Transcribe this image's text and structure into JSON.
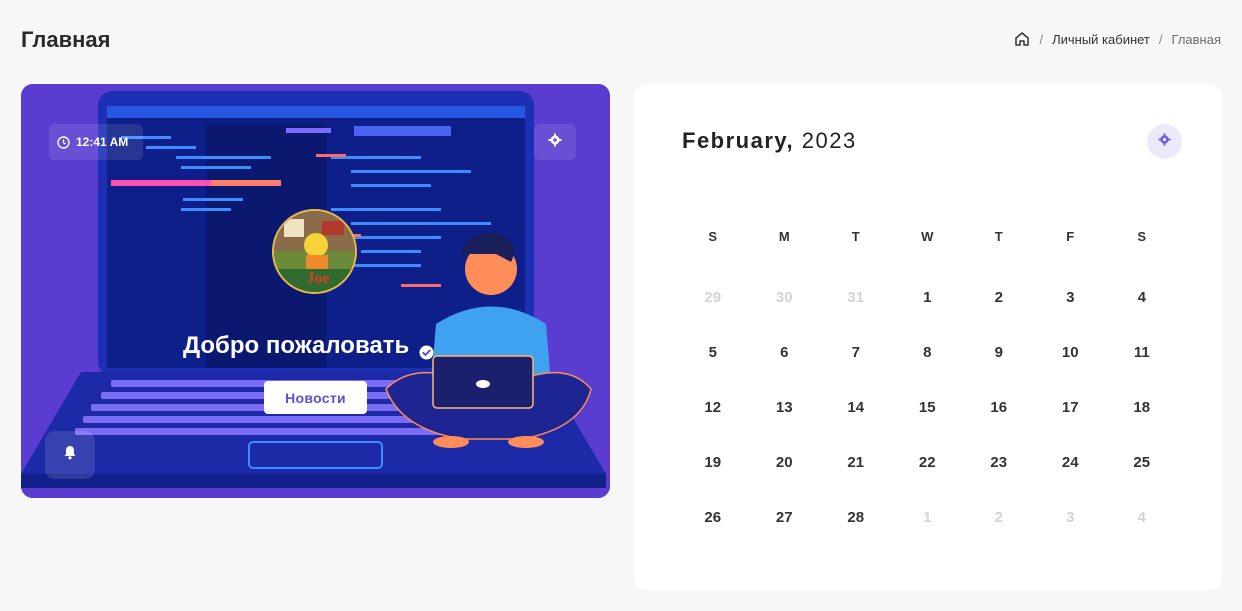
{
  "header": {
    "title": "Главная",
    "breadcrumb": [
      "Личный кабинет",
      "Главная"
    ]
  },
  "hero": {
    "time": "12:41 AM",
    "welcome": "Добро пожаловать",
    "news_button": "Новости",
    "bg_color": "#5b3fd0"
  },
  "calendar": {
    "month": "February,",
    "year": "2023",
    "weekdays": [
      "S",
      "M",
      "T",
      "W",
      "T",
      "F",
      "S"
    ],
    "days": [
      {
        "d": "29",
        "muted": true
      },
      {
        "d": "30",
        "muted": true
      },
      {
        "d": "31",
        "muted": true
      },
      {
        "d": "1"
      },
      {
        "d": "2"
      },
      {
        "d": "3"
      },
      {
        "d": "4"
      },
      {
        "d": "5"
      },
      {
        "d": "6"
      },
      {
        "d": "7"
      },
      {
        "d": "8"
      },
      {
        "d": "9"
      },
      {
        "d": "10"
      },
      {
        "d": "11"
      },
      {
        "d": "12"
      },
      {
        "d": "13"
      },
      {
        "d": "14"
      },
      {
        "d": "15"
      },
      {
        "d": "16"
      },
      {
        "d": "17"
      },
      {
        "d": "18"
      },
      {
        "d": "19"
      },
      {
        "d": "20"
      },
      {
        "d": "21"
      },
      {
        "d": "22"
      },
      {
        "d": "23"
      },
      {
        "d": "24"
      },
      {
        "d": "25"
      },
      {
        "d": "26"
      },
      {
        "d": "27"
      },
      {
        "d": "28"
      },
      {
        "d": "1",
        "muted": true
      },
      {
        "d": "2",
        "muted": true
      },
      {
        "d": "3",
        "muted": true
      },
      {
        "d": "4",
        "muted": true
      }
    ],
    "accent": "#6c5ce7"
  },
  "icons": {
    "home": "home-icon",
    "clock": "clock-icon",
    "gear": "gear-icon",
    "bell": "bell-icon",
    "verified": "verified-icon"
  }
}
